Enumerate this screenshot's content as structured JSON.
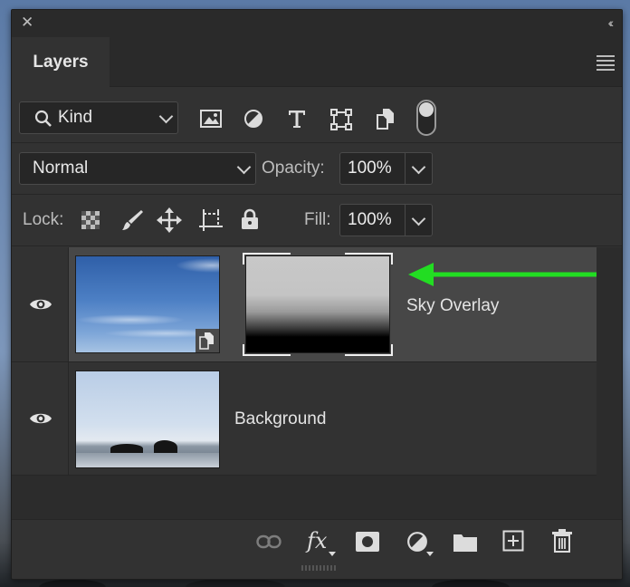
{
  "panel": {
    "tab_label": "Layers"
  },
  "filter": {
    "kind_label": "Kind"
  },
  "blend": {
    "mode": "Normal",
    "opacity_label": "Opacity:",
    "opacity_value": "100%"
  },
  "lock": {
    "lock_label": "Lock:",
    "fill_label": "Fill:",
    "fill_value": "100%"
  },
  "layers": [
    {
      "name": "Sky Overlay",
      "selected": true,
      "smart_object": true,
      "has_mask": true
    },
    {
      "name": "Background",
      "selected": false,
      "smart_object": false,
      "has_mask": false
    }
  ],
  "bottom_tools": {
    "fx_label": "fx"
  },
  "colors": {
    "panel": "#323232",
    "selected_row": "#474747",
    "annotation_arrow": "#22dd22"
  }
}
